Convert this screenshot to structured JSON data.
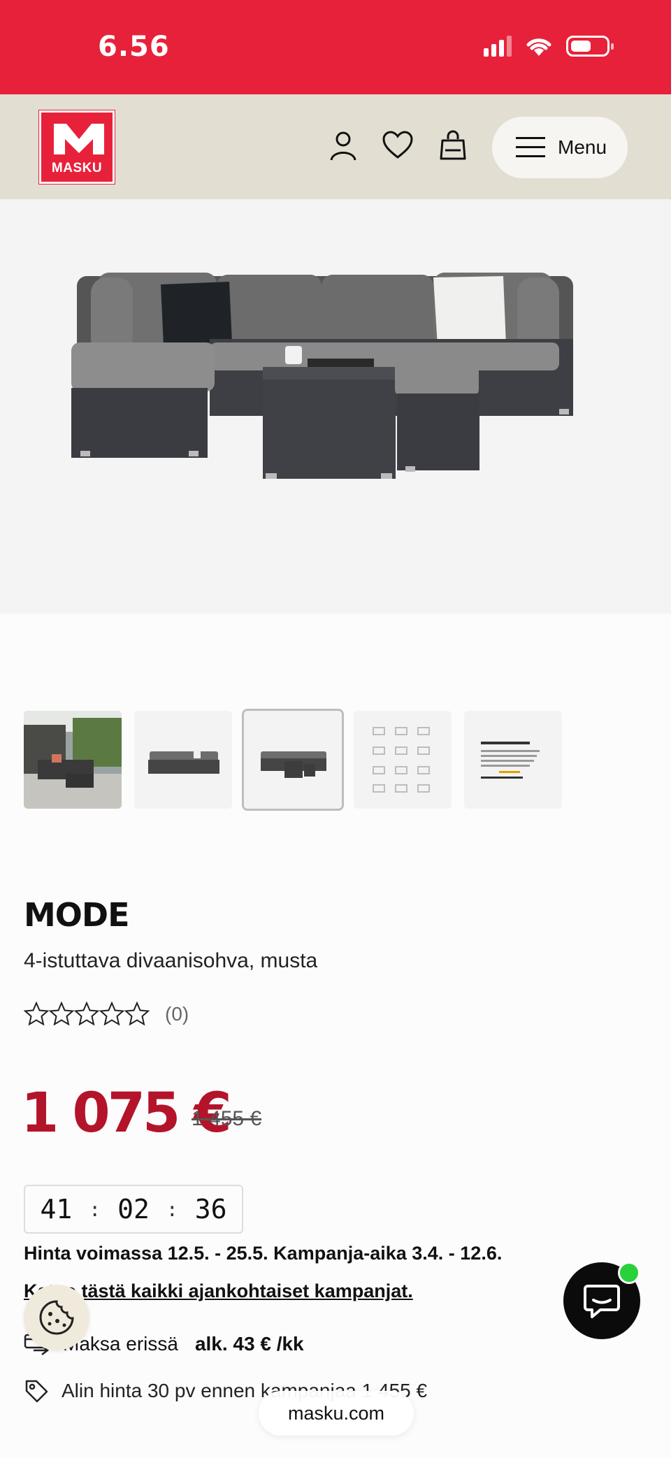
{
  "status_bar": {
    "time": "6.56"
  },
  "header": {
    "logo_text": "MASKU",
    "menu_label": "Menu"
  },
  "gallery": {
    "thumbnails": [
      "outdoor-scene",
      "sofa-side",
      "sofa-with-table",
      "module-diagrams",
      "info-card"
    ],
    "active_index": 2
  },
  "product": {
    "name": "MODE",
    "subtitle": "4-istuttava divaanisohva, musta",
    "rating_stars": 0,
    "rating_count": "(0)",
    "price": "1 075 €",
    "old_price": "1 455 €",
    "countdown": {
      "h": "41",
      "m": "02",
      "s": "36"
    },
    "validity": "Hinta voimassa 12.5. - 25.5. Kampanja-aika 3.4. - 12.6.",
    "campaign_link": "Katso tästä kaikki ajankohtaiset kampanjat.",
    "pay_label": "Maksa erissä",
    "pay_amount": "alk. 43 € /kk",
    "lowest_price": "Alin hinta 30 pv ennen kampanjaa 1 455 €"
  },
  "browser": {
    "url": "masku.com"
  },
  "colors": {
    "brand_red": "#e8213a",
    "price_red": "#b3142a",
    "header_beige": "#e3ded2",
    "chat_online": "#2ad13a"
  }
}
